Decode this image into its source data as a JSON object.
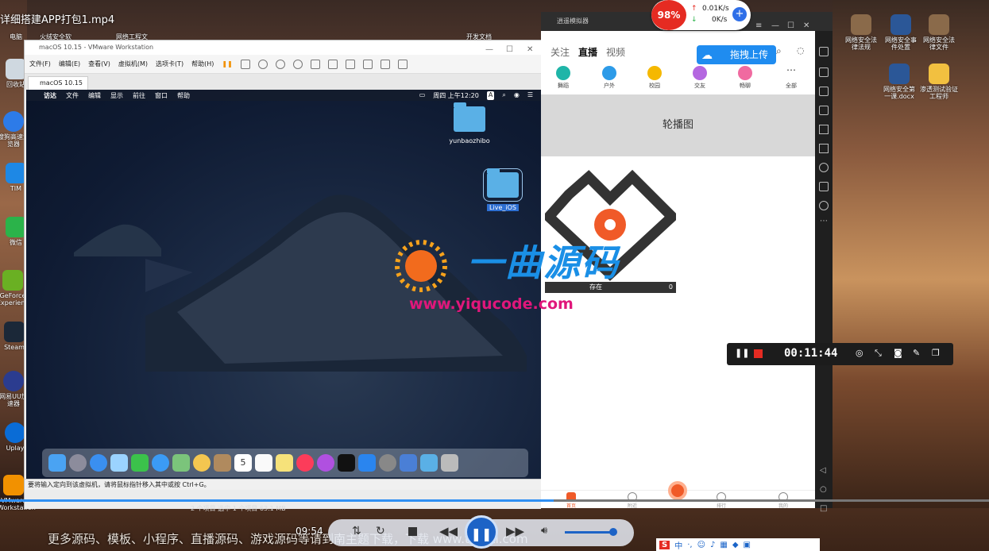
{
  "player": {
    "title": "详细搭建APP打包1.mp4",
    "time": "09:54",
    "subtitle": "更多源码、模板、小程序、直播源码、游戏源码等请到南主题下载，下载 www.tzhuti.com"
  },
  "desktop": {
    "left_icons": [
      "回收站",
      "搜狗高速浏览器",
      "TIM",
      "微信",
      "GeForce Experience",
      "Steam",
      "网易UU加速器",
      "Uplay",
      "VMware Workstation"
    ],
    "top_labels": [
      "电脑",
      "火绒安全软",
      "网络工程文",
      "开发文档"
    ],
    "right_icons": [
      "网络安全法律法规",
      "网络安全事件处置",
      "网络安全法律文件",
      "网络安全第一课.docx",
      "渗透测试验证工程师"
    ]
  },
  "vmware": {
    "title": "macOS 10.15 - VMware Workstation",
    "menu": [
      "文件(F)",
      "编辑(E)",
      "查看(V)",
      "虚拟机(M)",
      "选项卡(T)",
      "帮助(H)"
    ],
    "tab": "macOS 10.15",
    "status": "要将输入定向到该虚拟机，请将鼠标指针移入其中或按 Ctrl+G。",
    "finder_status": "2 个项目    选中 1 个项目  63.1 MB"
  },
  "mac": {
    "menu": [
      "访达",
      "文件",
      "编辑",
      "显示",
      "前往",
      "窗口",
      "帮助"
    ],
    "clock": "周四 上午12:20",
    "folders": [
      "yunbaozhibo",
      "Live_iOS"
    ]
  },
  "emulator": {
    "title": "逍遥模拟器",
    "tabs": [
      "关注",
      "直播",
      "视频"
    ],
    "categories": [
      "舞蹈",
      "户外",
      "校园",
      "交友",
      "畅聊",
      "全部"
    ],
    "banner": "轮播图",
    "card_caption": "存在",
    "card_count": "0",
    "nav": [
      "首页",
      "附近",
      "",
      "排行",
      "我的"
    ],
    "upload_button": "拖拽上传"
  },
  "net": {
    "cpu": "98%",
    "up": "0.01K/s",
    "down": "0K/s"
  },
  "recorder": {
    "time": "00:11:44"
  },
  "watermark": {
    "brand": "一曲源码",
    "url": "www.yiqucode.com"
  },
  "colors": {
    "accent_blue": "#2f8ff2",
    "app_orange": "#f05a28",
    "cpu_red": "#e52b22",
    "watermark_pink": "#e0177b"
  }
}
